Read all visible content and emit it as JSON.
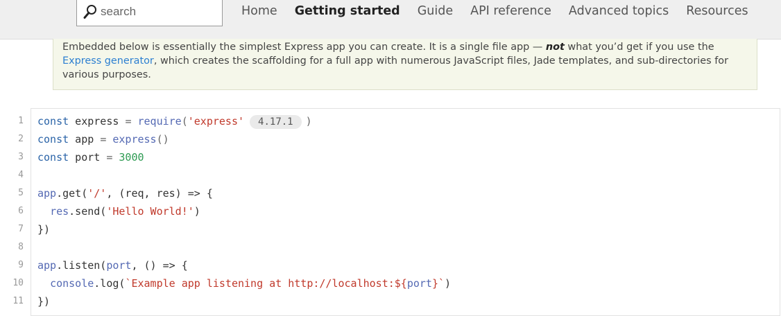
{
  "search": {
    "placeholder": "search"
  },
  "nav": {
    "items": [
      "Home",
      "Getting started",
      "Guide",
      "API reference",
      "Advanced topics",
      "Resources"
    ],
    "active_index": 1
  },
  "note": {
    "text_1": "Embedded below is essentially the simplest Express app you can create. It is a single file app — ",
    "emphasis": "not",
    "text_2": " what you’d get if you use the ",
    "link": "Express generator",
    "text_3": ", which creates the scaffolding for a full app with numerous JavaScript files, Jade templates, and sub-directories for various purposes."
  },
  "code": {
    "line_numbers": [
      "1",
      "2",
      "3",
      "4",
      "5",
      "6",
      "7",
      "8",
      "9",
      "10",
      "11"
    ],
    "version_badge": "4.17.1",
    "tokens": {
      "l1_kw": "const",
      "l1_var": " express ",
      "l1_op": "= ",
      "l1_fn": "require",
      "l1_p1": "(",
      "l1_str": "'express'",
      "l1_p2": ")",
      "l2_kw": "const",
      "l2_var": " app ",
      "l2_op": "= ",
      "l2_fn": "express",
      "l2_p": "()",
      "l3_kw": "const",
      "l3_var": " port ",
      "l3_op": "= ",
      "l3_num": "3000",
      "l5_obj": "app",
      "l5_dot": ".get(",
      "l5_str": "'/'",
      "l5_rest": ", (req, res) => {",
      "l6_indent": "  ",
      "l6_obj": "res",
      "l6_dot": ".send(",
      "l6_str": "'Hello World!'",
      "l6_end": ")",
      "l7": "})",
      "l9_obj": "app",
      "l9_dot": ".listen(",
      "l9_arg": "port",
      "l9_rest": ", () => {",
      "l10_indent": "  ",
      "l10_obj": "console",
      "l10_dot": ".log(",
      "l10_str": "`Example app listening at http://localhost:${",
      "l10_var": "port",
      "l10_str2": "}`",
      "l10_end": ")",
      "l11": "})"
    }
  }
}
